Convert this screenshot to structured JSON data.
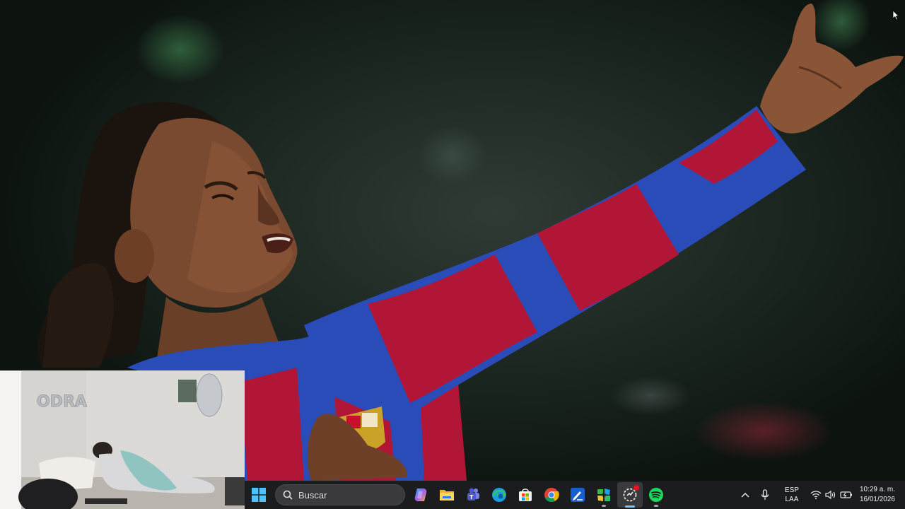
{
  "desktop": {
    "wallpaper_icon": "footballer-photo"
  },
  "taskbar": {
    "start_icon": "windows-logo-icon",
    "search": {
      "placeholder": "Buscar",
      "icon": "search-icon"
    },
    "apps": [
      {
        "name": "copilot",
        "icon": "copilot-icon",
        "running": false
      },
      {
        "name": "file-explorer",
        "icon": "folder-icon",
        "running": false
      },
      {
        "name": "teams",
        "icon": "teams-icon",
        "running": false
      },
      {
        "name": "edge",
        "icon": "edge-icon",
        "running": false
      },
      {
        "name": "microsoft-store",
        "icon": "store-icon",
        "running": false
      },
      {
        "name": "chrome",
        "icon": "chrome-icon",
        "running": false
      },
      {
        "name": "notes",
        "icon": "pen-app-icon",
        "running": false
      },
      {
        "name": "snipping",
        "icon": "colorful-grid-icon",
        "running": true
      },
      {
        "name": "recorder",
        "icon": "recording-app-icon",
        "running": true,
        "active": true
      },
      {
        "name": "spotify",
        "icon": "spotify-icon",
        "running": true
      }
    ],
    "tray": {
      "language_line1": "ESP",
      "language_line2": "LAA",
      "time": "10:29 a. m.",
      "date": "16/01/2026"
    }
  },
  "colors": {
    "taskbar_bg": "#1c1c1e",
    "accent": "#7cc1ff",
    "spotify_green": "#1ed760",
    "jersey_red": "#b21636",
    "jersey_blue": "#2a4cb8"
  }
}
